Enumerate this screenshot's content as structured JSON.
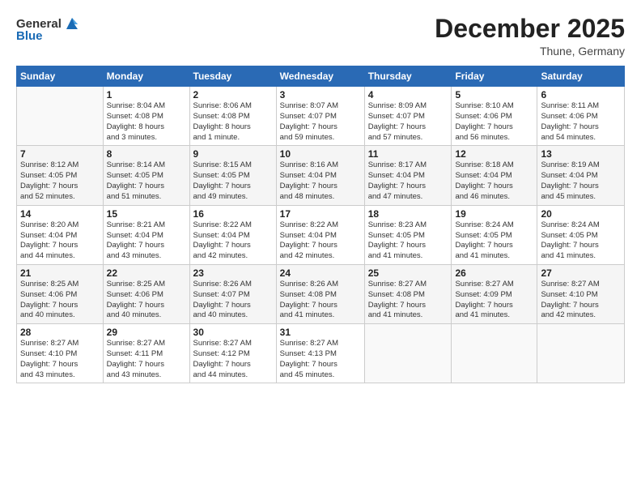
{
  "header": {
    "logo_general": "General",
    "logo_blue": "Blue",
    "month": "December 2025",
    "location": "Thune, Germany"
  },
  "days_of_week": [
    "Sunday",
    "Monday",
    "Tuesday",
    "Wednesday",
    "Thursday",
    "Friday",
    "Saturday"
  ],
  "weeks": [
    [
      {
        "day": "",
        "detail": ""
      },
      {
        "day": "1",
        "detail": "Sunrise: 8:04 AM\nSunset: 4:08 PM\nDaylight: 8 hours\nand 3 minutes."
      },
      {
        "day": "2",
        "detail": "Sunrise: 8:06 AM\nSunset: 4:08 PM\nDaylight: 8 hours\nand 1 minute."
      },
      {
        "day": "3",
        "detail": "Sunrise: 8:07 AM\nSunset: 4:07 PM\nDaylight: 7 hours\nand 59 minutes."
      },
      {
        "day": "4",
        "detail": "Sunrise: 8:09 AM\nSunset: 4:07 PM\nDaylight: 7 hours\nand 57 minutes."
      },
      {
        "day": "5",
        "detail": "Sunrise: 8:10 AM\nSunset: 4:06 PM\nDaylight: 7 hours\nand 56 minutes."
      },
      {
        "day": "6",
        "detail": "Sunrise: 8:11 AM\nSunset: 4:06 PM\nDaylight: 7 hours\nand 54 minutes."
      }
    ],
    [
      {
        "day": "7",
        "detail": "Sunrise: 8:12 AM\nSunset: 4:05 PM\nDaylight: 7 hours\nand 52 minutes."
      },
      {
        "day": "8",
        "detail": "Sunrise: 8:14 AM\nSunset: 4:05 PM\nDaylight: 7 hours\nand 51 minutes."
      },
      {
        "day": "9",
        "detail": "Sunrise: 8:15 AM\nSunset: 4:05 PM\nDaylight: 7 hours\nand 49 minutes."
      },
      {
        "day": "10",
        "detail": "Sunrise: 8:16 AM\nSunset: 4:04 PM\nDaylight: 7 hours\nand 48 minutes."
      },
      {
        "day": "11",
        "detail": "Sunrise: 8:17 AM\nSunset: 4:04 PM\nDaylight: 7 hours\nand 47 minutes."
      },
      {
        "day": "12",
        "detail": "Sunrise: 8:18 AM\nSunset: 4:04 PM\nDaylight: 7 hours\nand 46 minutes."
      },
      {
        "day": "13",
        "detail": "Sunrise: 8:19 AM\nSunset: 4:04 PM\nDaylight: 7 hours\nand 45 minutes."
      }
    ],
    [
      {
        "day": "14",
        "detail": "Sunrise: 8:20 AM\nSunset: 4:04 PM\nDaylight: 7 hours\nand 44 minutes."
      },
      {
        "day": "15",
        "detail": "Sunrise: 8:21 AM\nSunset: 4:04 PM\nDaylight: 7 hours\nand 43 minutes."
      },
      {
        "day": "16",
        "detail": "Sunrise: 8:22 AM\nSunset: 4:04 PM\nDaylight: 7 hours\nand 42 minutes."
      },
      {
        "day": "17",
        "detail": "Sunrise: 8:22 AM\nSunset: 4:04 PM\nDaylight: 7 hours\nand 42 minutes."
      },
      {
        "day": "18",
        "detail": "Sunrise: 8:23 AM\nSunset: 4:05 PM\nDaylight: 7 hours\nand 41 minutes."
      },
      {
        "day": "19",
        "detail": "Sunrise: 8:24 AM\nSunset: 4:05 PM\nDaylight: 7 hours\nand 41 minutes."
      },
      {
        "day": "20",
        "detail": "Sunrise: 8:24 AM\nSunset: 4:05 PM\nDaylight: 7 hours\nand 41 minutes."
      }
    ],
    [
      {
        "day": "21",
        "detail": "Sunrise: 8:25 AM\nSunset: 4:06 PM\nDaylight: 7 hours\nand 40 minutes."
      },
      {
        "day": "22",
        "detail": "Sunrise: 8:25 AM\nSunset: 4:06 PM\nDaylight: 7 hours\nand 40 minutes."
      },
      {
        "day": "23",
        "detail": "Sunrise: 8:26 AM\nSunset: 4:07 PM\nDaylight: 7 hours\nand 40 minutes."
      },
      {
        "day": "24",
        "detail": "Sunrise: 8:26 AM\nSunset: 4:08 PM\nDaylight: 7 hours\nand 41 minutes."
      },
      {
        "day": "25",
        "detail": "Sunrise: 8:27 AM\nSunset: 4:08 PM\nDaylight: 7 hours\nand 41 minutes."
      },
      {
        "day": "26",
        "detail": "Sunrise: 8:27 AM\nSunset: 4:09 PM\nDaylight: 7 hours\nand 41 minutes."
      },
      {
        "day": "27",
        "detail": "Sunrise: 8:27 AM\nSunset: 4:10 PM\nDaylight: 7 hours\nand 42 minutes."
      }
    ],
    [
      {
        "day": "28",
        "detail": "Sunrise: 8:27 AM\nSunset: 4:10 PM\nDaylight: 7 hours\nand 43 minutes."
      },
      {
        "day": "29",
        "detail": "Sunrise: 8:27 AM\nSunset: 4:11 PM\nDaylight: 7 hours\nand 43 minutes."
      },
      {
        "day": "30",
        "detail": "Sunrise: 8:27 AM\nSunset: 4:12 PM\nDaylight: 7 hours\nand 44 minutes."
      },
      {
        "day": "31",
        "detail": "Sunrise: 8:27 AM\nSunset: 4:13 PM\nDaylight: 7 hours\nand 45 minutes."
      },
      {
        "day": "",
        "detail": ""
      },
      {
        "day": "",
        "detail": ""
      },
      {
        "day": "",
        "detail": ""
      }
    ]
  ]
}
